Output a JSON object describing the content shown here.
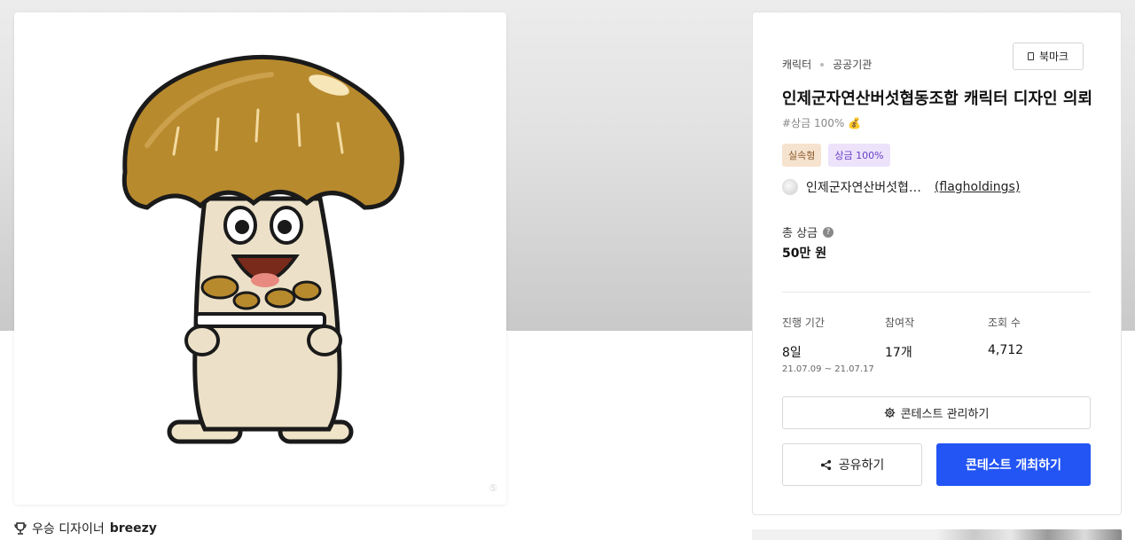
{
  "artwork": {
    "watermark": "⑤",
    "winner_label": "우승 디자이너",
    "winner_name": "breezy"
  },
  "panel": {
    "categories": [
      "캐릭터",
      "공공기관"
    ],
    "bookmark_label": "북마크",
    "title": "인제군자연산버섯협동조합 캐릭터 디자인 의뢰",
    "hashtag": "#상금 100% 💰",
    "tags": [
      "실속형",
      "상금 100%"
    ],
    "host_name": "인제군자연산버섯협…",
    "host_id": "(flagholdings)",
    "prize_label": "총 상금",
    "help_glyph": "?",
    "prize_value": "50만 원",
    "stats": {
      "period_label": "진행 기간",
      "period_value": "8일",
      "period_dates": "21.07.09 ~ 21.07.17",
      "entries_label": "참여작",
      "entries_value": "17개",
      "views_label": "조회 수",
      "views_value": "4,712"
    },
    "manage_button": "콘테스트 관리하기",
    "share_button": "공유하기",
    "host_button": "콘테스트 개최하기",
    "accent_color": "#2355f5"
  }
}
